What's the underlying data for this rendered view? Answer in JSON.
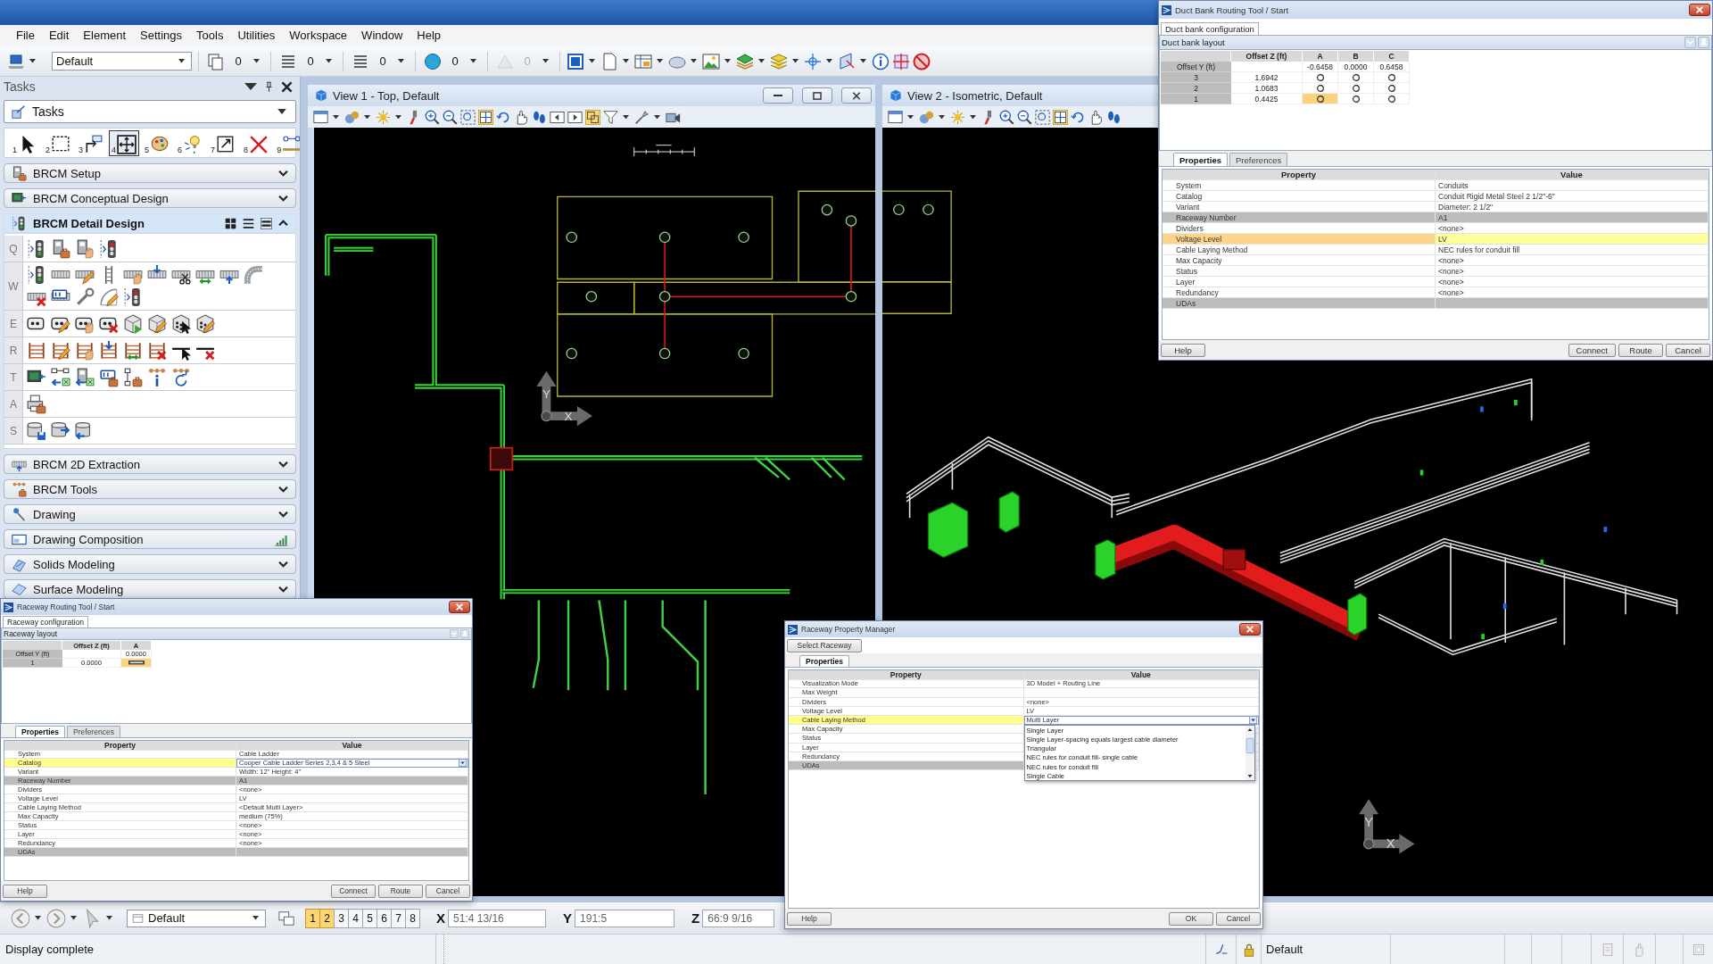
{
  "menu_bar": {
    "items": [
      "File",
      "Edit",
      "Element",
      "Settings",
      "Tools",
      "Utilities",
      "Workspace",
      "Window",
      "Help"
    ]
  },
  "main_toolbar": {
    "workspace": "Default",
    "counters": [
      {
        "value": "0",
        "disabled": false
      },
      {
        "value": "0",
        "disabled": false
      },
      {
        "value": "0",
        "disabled": false
      },
      {
        "value": "0",
        "disabled": false
      },
      {
        "value": "0",
        "disabled": true
      }
    ]
  },
  "tasks_panel": {
    "title": "Tasks",
    "task_set": "Tasks",
    "tools": [
      {
        "number": "1",
        "selected": false
      },
      {
        "number": "2",
        "selected": false
      },
      {
        "number": "3",
        "selected": false
      },
      {
        "number": "4",
        "selected": true
      },
      {
        "number": "5",
        "selected": false
      },
      {
        "number": "6",
        "selected": false
      },
      {
        "number": "7",
        "selected": false
      },
      {
        "number": "8",
        "selected": false
      },
      {
        "number": "9",
        "selected": false
      }
    ],
    "sections": [
      {
        "label": "BRCM Setup",
        "kind": "group",
        "expanded": false
      },
      {
        "label": "BRCM Conceptual Design",
        "kind": "group",
        "expanded": false
      },
      {
        "label": "BRCM Detail Design",
        "kind": "group",
        "expanded": true,
        "tool_rows": [
          {
            "letter": "Q"
          },
          {
            "letter": "W"
          },
          {
            "letter": "E"
          },
          {
            "letter": "R"
          },
          {
            "letter": "T"
          },
          {
            "letter": "A"
          },
          {
            "letter": "S"
          }
        ]
      },
      {
        "label": "BRCM 2D Extraction",
        "kind": "group",
        "expanded": false
      },
      {
        "label": "BRCM Tools",
        "kind": "group",
        "expanded": false
      },
      {
        "label": "Drawing",
        "kind": "group",
        "expanded": false
      },
      {
        "label": "Drawing Composition",
        "kind": "launcher",
        "expanded": false
      },
      {
        "label": "Solids Modeling",
        "kind": "group",
        "expanded": false
      },
      {
        "label": "Surface Modeling",
        "kind": "group",
        "expanded": false
      }
    ]
  },
  "views": [
    {
      "title": "View 1 - Top, Default",
      "kind": "top",
      "axis_labels": [
        "Y",
        "X"
      ]
    },
    {
      "title": "View 2 - Isometric, Default",
      "kind": "isometric",
      "axis_labels": [
        "Y",
        "X"
      ]
    }
  ],
  "duct_bank_dialog": {
    "title": "Duct Bank Routing Tool / Start",
    "config_tab": "Duct bank configuration",
    "layout_title": "Duct bank layout",
    "layout": {
      "kind": "conduit",
      "columns": [
        "Offset Z (ft)",
        "A",
        "B",
        "C"
      ],
      "offset_label": "Offset Y (ft)",
      "offsets": [
        "-0.6458",
        "0.0000",
        "0.6458"
      ],
      "rows": [
        {
          "label": "3",
          "offset_z": "1.6942",
          "cells": [
            {
              "selected": false
            },
            {
              "selected": false
            },
            {
              "selected": false
            }
          ]
        },
        {
          "label": "2",
          "offset_z": "1.0683",
          "cells": [
            {
              "selected": false
            },
            {
              "selected": false
            },
            {
              "selected": false
            }
          ]
        },
        {
          "label": "1",
          "offset_z": "0.4425",
          "cells": [
            {
              "selected": true
            },
            {
              "selected": false
            },
            {
              "selected": false
            }
          ]
        }
      ]
    },
    "tabs": [
      {
        "label": "Properties",
        "selected": true
      },
      {
        "label": "Preferences",
        "selected": false
      }
    ],
    "property_table": {
      "columns": [
        "Property",
        "Value"
      ],
      "rows": [
        {
          "property": "System",
          "value": "Conduits",
          "kind": "text",
          "selected": false
        },
        {
          "property": "Catalog",
          "value": "Conduit Rigid Metal Steel 2 1/2\"-6\"",
          "kind": "text",
          "selected": false
        },
        {
          "property": "Variant",
          "value": "Diameter: 2 1/2\"",
          "kind": "text",
          "selected": false
        },
        {
          "property": "Raceway Number",
          "value": "A1",
          "kind": "readonly",
          "selected": false
        },
        {
          "property": "Dividers",
          "value": "<none>",
          "kind": "text",
          "selected": false
        },
        {
          "property": "Voltage Level",
          "value": "LV",
          "kind": "text",
          "selected": true
        },
        {
          "property": "Cable Laying Method",
          "value": "NEC rules for conduit fill",
          "kind": "text",
          "selected": false
        },
        {
          "property": "Max Capacity",
          "value": "<none>",
          "kind": "text",
          "selected": false
        },
        {
          "property": "Status",
          "value": "<none>",
          "kind": "text",
          "selected": false
        },
        {
          "property": "Layer",
          "value": "<none>",
          "kind": "text",
          "selected": false
        },
        {
          "property": "Redundancy",
          "value": "<none>",
          "kind": "text",
          "selected": false
        },
        {
          "property": "UDAs",
          "kind": "category",
          "selected": false
        }
      ]
    },
    "buttons": [
      "Help",
      "Connect",
      "Route",
      "Cancel"
    ]
  },
  "raceway_dialog": {
    "title": "Raceway Routing Tool / Start",
    "config_tab": "Raceway configuration",
    "layout_title": "Raceway layout",
    "layout": {
      "kind": "tray",
      "columns": [
        "Offset Z (ft)",
        "A"
      ],
      "offset_label": "Offset Y (ft)",
      "offsets": [
        "0.0000"
      ],
      "rows": [
        {
          "label": "1",
          "offset_z": "0.0000",
          "cells": [
            {
              "selected": true
            }
          ]
        }
      ]
    },
    "tabs": [
      {
        "label": "Properties",
        "selected": true
      },
      {
        "label": "Preferences",
        "selected": false
      }
    ],
    "property_table": {
      "columns": [
        "Property",
        "Value"
      ],
      "rows": [
        {
          "property": "System",
          "value": "Cable Ladder",
          "kind": "text",
          "selected": false
        },
        {
          "property": "Catalog",
          "value": "Cooper Cable Ladder Series 2,3,4 & 5 Steel",
          "kind": "choice",
          "selected": true
        },
        {
          "property": "Variant",
          "value": "Width: 12\" Height: 4\"",
          "kind": "text",
          "selected": false
        },
        {
          "property": "Raceway Number",
          "value": "A1",
          "kind": "readonly",
          "selected": false
        },
        {
          "property": "Dividers",
          "value": "<none>",
          "kind": "text",
          "selected": false
        },
        {
          "property": "Voltage Level",
          "value": "LV",
          "kind": "text",
          "selected": false
        },
        {
          "property": "Cable Laying Method",
          "value": "<Default Multi Layer>",
          "kind": "text",
          "selected": false
        },
        {
          "property": "Max Capacity",
          "value": "medium (75%)",
          "kind": "text",
          "selected": false
        },
        {
          "property": "Status",
          "value": "<none>",
          "kind": "text",
          "selected": false
        },
        {
          "property": "Layer",
          "value": "<none>",
          "kind": "text",
          "selected": false
        },
        {
          "property": "Redundancy",
          "value": "<none>",
          "kind": "text",
          "selected": false
        },
        {
          "property": "UDAs",
          "kind": "category",
          "selected": false
        }
      ]
    },
    "buttons": [
      "Help",
      "Connect",
      "Route",
      "Cancel"
    ]
  },
  "property_manager": {
    "title": "Raceway Property Manager",
    "select_button": "Select Raceway",
    "tabs": [
      {
        "label": "Properties",
        "selected": true
      }
    ],
    "property_table": {
      "columns": [
        "Property",
        "Value"
      ],
      "rows": [
        {
          "property": "Visualization Mode",
          "value": "3D Model + Routing Line",
          "kind": "text",
          "selected": false
        },
        {
          "property": "Max Weight",
          "kind": "text",
          "selected": false
        },
        {
          "property": "Dividers",
          "value": "<none>",
          "kind": "text",
          "selected": false
        },
        {
          "property": "Voltage Level",
          "value": "LV",
          "kind": "text",
          "selected": false
        },
        {
          "property": "Cable Laying Method",
          "value": "Multi Layer",
          "kind": "choice",
          "selected": true
        },
        {
          "property": "Max Capacity",
          "kind": "text",
          "selected": false
        },
        {
          "property": "Status",
          "kind": "text",
          "selected": false
        },
        {
          "property": "Layer",
          "kind": "text",
          "selected": false
        },
        {
          "property": "Redundancy",
          "kind": "text",
          "selected": false
        },
        {
          "property": "UDAs",
          "kind": "category",
          "selected": false
        }
      ]
    },
    "dropdown": {
      "options": [
        "Single Layer",
        "Single Layer-spacing equals largest cable diameter",
        "Triangular",
        "NEC rules for conduit fill- single cable",
        "NEC rules for conduit fill",
        "Single Cable"
      ]
    },
    "buttons": [
      "Help",
      "OK",
      "Cancel"
    ]
  },
  "view_bar": {
    "level": "Default",
    "view_buttons": [
      {
        "label": "1",
        "on": true
      },
      {
        "label": "2",
        "on": true
      },
      {
        "label": "3",
        "on": false
      },
      {
        "label": "4",
        "on": false
      },
      {
        "label": "5",
        "on": false
      },
      {
        "label": "6",
        "on": false
      },
      {
        "label": "7",
        "on": false
      },
      {
        "label": "8",
        "on": false
      }
    ],
    "coordinates": [
      {
        "axis": "X",
        "value": "51:4 13/16"
      },
      {
        "axis": "Y",
        "value": "191:5"
      },
      {
        "axis": "Z",
        "value": "66:9 9/16"
      }
    ]
  },
  "status_bar": {
    "message": "Display complete",
    "level": "Default"
  }
}
